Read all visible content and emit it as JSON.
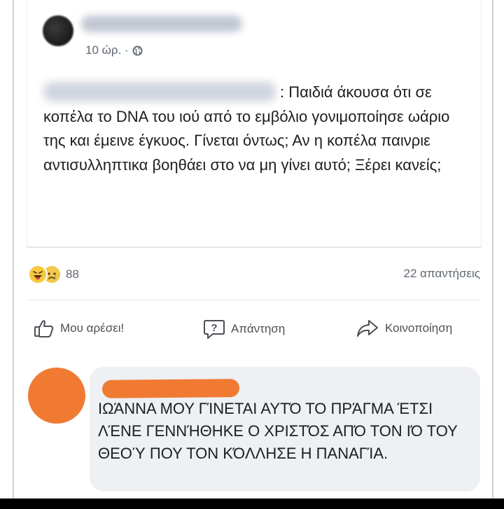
{
  "post": {
    "time": "10 ώρ. ·",
    "text_line1": ": Παιδιά άκουσα ότι",
    "text_rest": "σε κοπέλα το DNA του ιού από το εμβόλιο γονιμοποίησε ωάριο της και έμεινε έγκυος. Γίνεται όντως; Αν η κοπέλα παινριε αντισυλληπτικα βοηθάει στο να μη γίνει αυτό; Ξέρει κανείς;"
  },
  "reactions": {
    "icons": [
      "haha-emoji",
      "sad-emoji"
    ],
    "count": "88",
    "replies": "22 απαντήσεις"
  },
  "actions": {
    "like": "Μου αρέσει!",
    "reply": "Απάντηση",
    "share": "Κοινοποίηση"
  },
  "comment": {
    "text": "ΙΩΆΝΝΑ ΜΟΥ ΓΊΝΕΤΑΙ ΑΥΤΌ ΤΟ ΠΡΆΓΜΑ ΈΤΣΙ ΛΈΝΕ ΓΕΝΝΉΘΗΚΕ Ο ΧΡΙΣΤΌΣ ΑΠΌ ΤΟΝ ΙΌ ΤΟΥ ΘΕΟΎ ΠΟΥ ΤΟΝ ΚΌΛΛΗΣΕ Η ΠΑΝΑΓΊΑ."
  },
  "colors": {
    "redaction": "#f07a32",
    "comment_bubble": "#eef0f3",
    "meta_text": "#606770"
  }
}
